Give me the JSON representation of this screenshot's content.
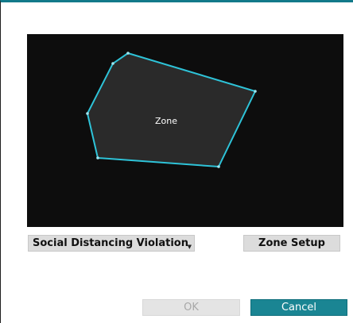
{
  "preview": {
    "zone_label": "Zone",
    "polygon_color": "#2ec3d8",
    "fill_color": "#2a2a2a"
  },
  "controls": {
    "event_type_value": "Social Distancing Violation",
    "zone_setup_label": "Zone Setup"
  },
  "footer": {
    "ok_label": "OK",
    "cancel_label": "Cancel"
  },
  "colors": {
    "accent": "#1a8593",
    "title_bar": "#127a8a"
  }
}
